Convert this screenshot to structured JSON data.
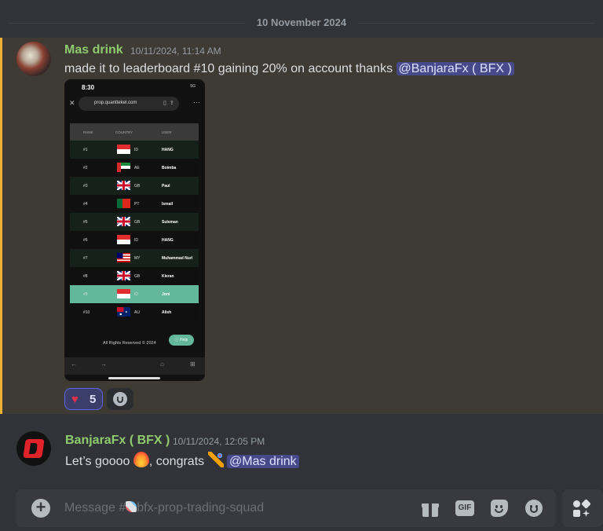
{
  "date_divider": "10 November 2024",
  "messages": [
    {
      "author": "Mas drink",
      "author_color": "#8ecb6e",
      "timestamp": "10/11/2024, 11:14 AM",
      "text": "made it to leaderboard #10 gaining 20% on account  thanks ",
      "mention": "@BanjaraFx ( BFX )",
      "highlighted": true,
      "attachment": {
        "status_time": "8:30",
        "status_right": "5G",
        "url": "prop.quanttekel.com",
        "columns": [
          "RANK",
          "COUNTRY",
          "USER"
        ],
        "rows": [
          {
            "rank": "#1",
            "flag": "id",
            "country": "ID",
            "user": "HANG"
          },
          {
            "rank": "#2",
            "flag": "ae",
            "country": "AE",
            "user": "Boimba"
          },
          {
            "rank": "#3",
            "flag": "gb",
            "country": "GB",
            "user": "Paul"
          },
          {
            "rank": "#4",
            "flag": "pt",
            "country": "PT",
            "user": "Ismail"
          },
          {
            "rank": "#5",
            "flag": "gb",
            "country": "GB",
            "user": "Suleman"
          },
          {
            "rank": "#6",
            "flag": "id",
            "country": "ID",
            "user": "HANG"
          },
          {
            "rank": "#7",
            "flag": "my",
            "country": "MY",
            "user": "Muhammad Nurl"
          },
          {
            "rank": "#8",
            "flag": "gb",
            "country": "GB",
            "user": "Kieran"
          },
          {
            "rank": "#9",
            "flag": "id",
            "country": "ID",
            "user": "Joni",
            "highlighted": true
          },
          {
            "rank": "#10",
            "flag": "au",
            "country": "AU",
            "user": "Alish"
          }
        ],
        "footer": "All Rights Reserved © 2024",
        "help_label": "Help"
      },
      "reactions": [
        {
          "emoji": "heart",
          "count": "5",
          "selected": true
        }
      ]
    },
    {
      "author": "BanjaraFx ( BFX )",
      "author_color": "#8ecb6e",
      "timestamp": "10/11/2024, 12:05 PM",
      "text_before": "Let’s goooo ",
      "text_middle": ", congrats ",
      "mention": "@Mas drink",
      "emojis": [
        "fire",
        "party-popper"
      ]
    }
  ],
  "composer": {
    "placeholder_prefix": "Message #",
    "channel": "bfx-prop-trading-squad",
    "icons": [
      "gift-icon",
      "gif-icon",
      "sticker-icon",
      "emoji-icon",
      "apps-icon"
    ],
    "gif_label": "GIF"
  },
  "colors": {
    "accent": "#5865f2",
    "highlight_bar": "#f0b232",
    "mention_bg": "#474a8a",
    "table_highlight": "#63b79a"
  }
}
